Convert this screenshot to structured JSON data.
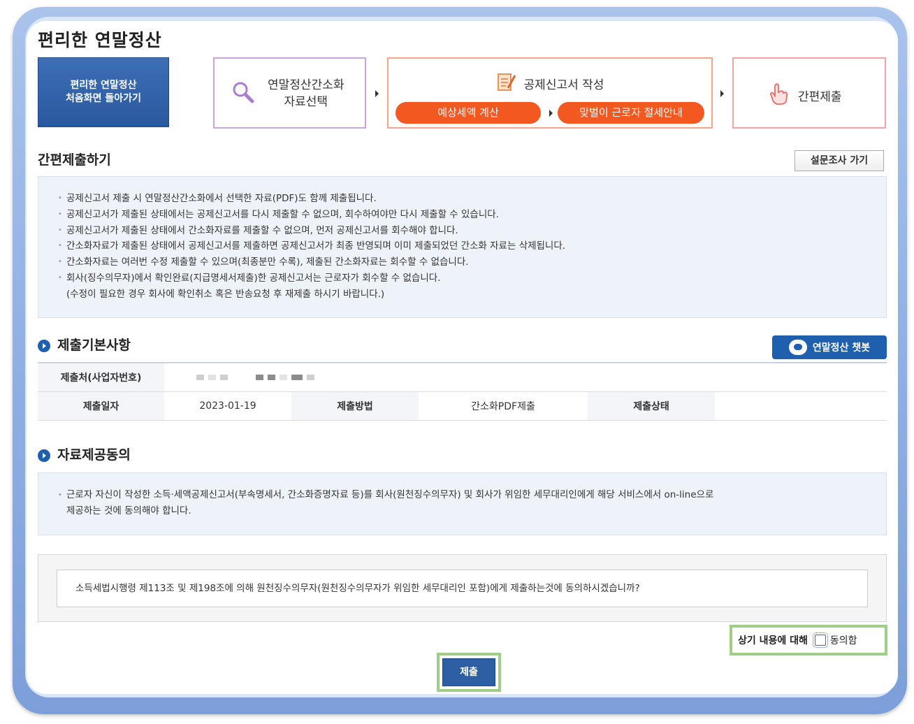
{
  "page_title": "편리한 연말정산",
  "home_button": {
    "line1": "편리한 연말정산",
    "line2": "처음화면 돌아가기"
  },
  "steps": {
    "step1": {
      "line1": "연말정산간소화",
      "line2": "자료선택",
      "icon": "magnifier-icon"
    },
    "step2": {
      "label": "공제신고서 작성",
      "icon": "document-pencil-icon",
      "pill1": "예상세액 계산",
      "pill2": "맞벌이 근로자 절세안내"
    },
    "step3": {
      "label": "간편제출",
      "icon": "pointing-hand-icon"
    }
  },
  "section_main": {
    "title": "간편제출하기",
    "survey_button": "설문조사 가기"
  },
  "notices": [
    "공제신고서 제출 시 연말정산간소화에서 선택한 자료(PDF)도 함께 제출됩니다.",
    "공제신고서가 제출된 상태에서는 공제신고서를 다시 제출할 수 없으며, 회수하여야만 다시 제출할 수 있습니다.",
    "공제신고서가 제출된 상태에서 간소화자료를 제출할 수 없으며, 먼저 공제신고서를 회수해야 합니다.",
    "간소화자료가 제출된 상태에서 공제신고서를 제출하면 공제신고서가 최종 반영되며 이미 제출되었던 간소화 자료는 삭제됩니다.",
    "간소화자료는 여러번 수정 제출할 수 있으며(최종분만 수록), 제출된 간소화자료는 회수할 수 없습니다.",
    "회사(징수의무자)에서 확인완료(지급명세서제출)한 공제신고서는 근로자가 회수할 수 없습니다."
  ],
  "notice_sub": "(수정이 필요한 경우 회사에 확인취소 혹은 반송요청 후 재제출 하시기 바랍니다.)",
  "basic_info": {
    "title": "제출기본사항",
    "chatbot_button": "연말정산 챗봇",
    "labels": {
      "submitter": "제출처(사업자번호)",
      "date": "제출일자",
      "method": "제출방법",
      "status": "제출상태"
    },
    "values": {
      "date": "2023-01-19",
      "method": "간소화PDF제출",
      "status": ""
    }
  },
  "consent": {
    "title": "자료제공동의",
    "text_line1": "근로자 자신이 작성한 소득·세액공제신고서(부속명세서, 간소화증명자료 등)를 회사(원천징수의무자) 및 회사가 위임한 세무대리인에게 해당 서비스에서 on-line으로",
    "text_line2": "제공하는 것에 동의해야 합니다.",
    "question": "소득세법시행령 제113조 및 제198조에 의해 원천징수의무자(원천징수의무자가 위임한 세무대리인 포함)에게 제출하는것에 동의하시겠습니까?",
    "agree_prefix": "상기 내용에 대해",
    "agree_label": "동의함",
    "agree_checked": false
  },
  "submit_button": "제출"
}
